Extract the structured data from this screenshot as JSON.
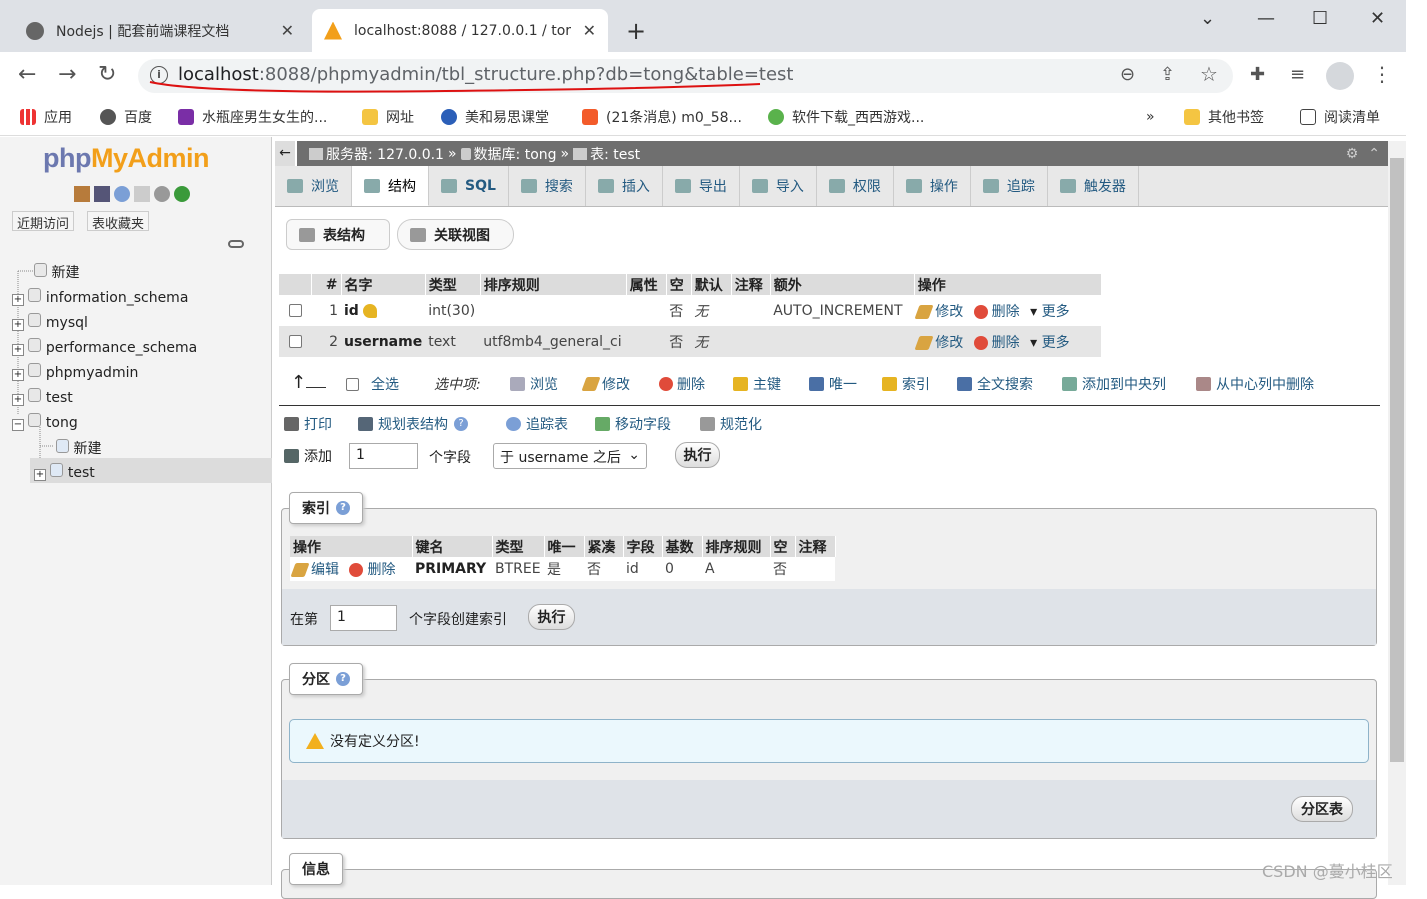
{
  "browser": {
    "tabs": [
      {
        "title": "Nodejs | 配套前端课程文档",
        "close": "✕"
      },
      {
        "title": "localhost:8088 / 127.0.0.1 / tor",
        "close": "✕"
      }
    ],
    "new_tab": "+",
    "url_host": "localhost",
    "url_rest": ":8088/phpmyadmin/tbl_structure.php?db=tong&table=test",
    "bookmarks": [
      "应用",
      "百度",
      "水瓶座男生女生的...",
      "网址",
      "美和易思课堂",
      "(21条消息) m0_58...",
      "软件下载_西西游戏..."
    ],
    "bookmarks_more": "»",
    "other_bookmarks": "其他书签",
    "reading_list": "阅读清单"
  },
  "sidebar": {
    "logo_php": "php",
    "logo_my": "MyAdmin",
    "recent": "近期访问",
    "favorites": "表收藏夹",
    "tree": [
      "新建",
      "information_schema",
      "mysql",
      "performance_schema",
      "phpmyadmin",
      "test",
      "tong",
      "新建",
      "test"
    ]
  },
  "breadcrumb": {
    "server": "服务器: 127.0.0.1",
    "sep1": "»",
    "db": "数据库: tong",
    "sep2": "»",
    "table": "表: test"
  },
  "topnav": [
    "浏览",
    "结构",
    "SQL",
    "搜索",
    "插入",
    "导出",
    "导入",
    "权限",
    "操作",
    "追踪",
    "触发器"
  ],
  "subtabs": [
    "表结构",
    "关联视图"
  ],
  "structure": {
    "headers": [
      "#",
      "名字",
      "类型",
      "排序规则",
      "属性",
      "空",
      "默认",
      "注释",
      "额外",
      "操作"
    ],
    "rows": [
      {
        "num": "1",
        "name": "id",
        "type": "int(30)",
        "collation": "",
        "attr": "",
        "null": "否",
        "default": "无",
        "comment": "",
        "extra": "AUTO_INCREMENT",
        "edit": "修改",
        "drop": "删除",
        "more": "更多"
      },
      {
        "num": "2",
        "name": "username",
        "type": "text",
        "collation": "utf8mb4_general_ci",
        "attr": "",
        "null": "否",
        "default": "无",
        "comment": "",
        "extra": "",
        "edit": "修改",
        "drop": "删除",
        "more": "更多"
      }
    ]
  },
  "bulk": {
    "check_all": "全选",
    "with_selected": "选中项:",
    "actions": [
      "浏览",
      "修改",
      "删除",
      "主键",
      "唯一",
      "索引",
      "全文搜索",
      "添加到中央列",
      "从中心列中删除"
    ]
  },
  "tools": [
    "打印",
    "规划表结构",
    "追踪表",
    "移动字段",
    "规范化"
  ],
  "add": {
    "label": "添加",
    "count": "1",
    "unit": "个字段",
    "position": "于 username 之后",
    "go": "执行"
  },
  "indexes": {
    "legend": "索引",
    "headers": [
      "操作",
      "键名",
      "类型",
      "唯一",
      "紧凑",
      "字段",
      "基数",
      "排序规则",
      "空",
      "注释"
    ],
    "row": {
      "edit": "编辑",
      "drop": "删除",
      "key": "PRIMARY",
      "type": "BTREE",
      "unique": "是",
      "packed": "否",
      "column": "id",
      "cardinality": "0",
      "collation": "A",
      "null": "否",
      "comment": ""
    },
    "create_prefix": "在第",
    "create_count": "1",
    "create_suffix": "个字段创建索引",
    "go": "执行"
  },
  "partitions": {
    "legend": "分区",
    "message": "没有定义分区!",
    "button": "分区表"
  },
  "info": {
    "legend": "信息"
  },
  "watermark": "CSDN @蔓小桂区"
}
